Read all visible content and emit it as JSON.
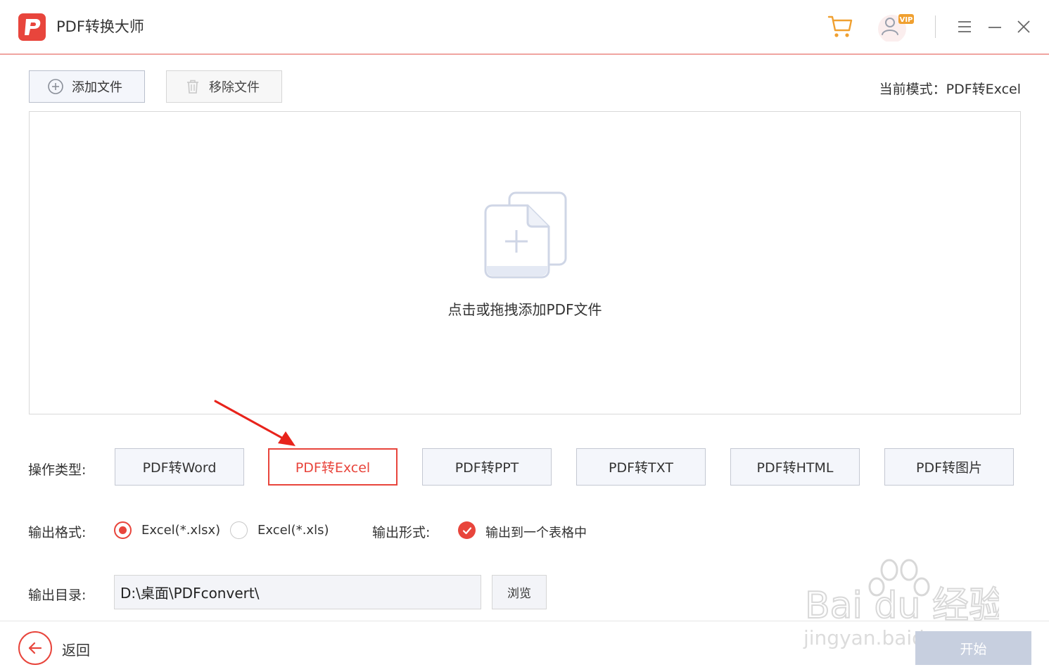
{
  "titlebar": {
    "app_title": "PDF转换大师",
    "logo_letter": "P",
    "user_badge": "VIP"
  },
  "toolbar": {
    "add_label": "添加文件",
    "remove_label": "移除文件",
    "mode_text": "当前模式：PDF转Excel"
  },
  "dropzone": {
    "hint": "点击或拖拽添加PDF文件"
  },
  "operation": {
    "label": "操作类型:",
    "types": [
      "PDF转Word",
      "PDF转Excel",
      "PDF转PPT",
      "PDF转TXT",
      "PDF转HTML",
      "PDF转图片"
    ],
    "selected": "PDF转Excel"
  },
  "output_format": {
    "label": "输出格式:",
    "options": [
      "Excel(*.xlsx)",
      "Excel(*.xls)"
    ],
    "selected": "Excel(*.xlsx)",
    "form_label": "输出形式:",
    "form_option": "输出到一个表格中",
    "form_checked": true
  },
  "output_dir": {
    "label": "输出目录:",
    "value": "D:\\桌面\\PDFconvert\\",
    "browse_label": "浏览"
  },
  "footer": {
    "back_label": "返回",
    "start_label": "开始"
  },
  "watermark": {
    "brand": "Bai du 经验",
    "url": "jingyan.baidu.com"
  },
  "colors": {
    "accent": "#e8453c",
    "button_bg": "#f4f6fb",
    "start_disabled": "#c7cfdf"
  }
}
